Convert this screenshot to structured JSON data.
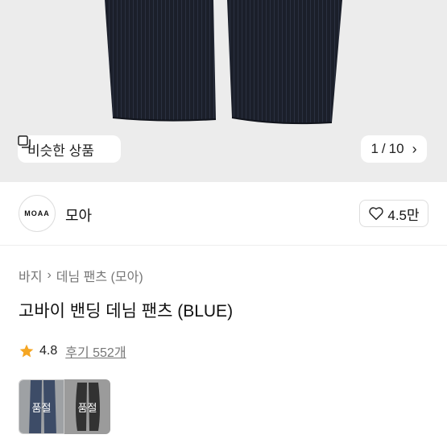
{
  "hero": {
    "similar_label": "비슷한 상품",
    "similar_icon": "similar-items-icon",
    "pager": {
      "current": "1",
      "separator": "/",
      "total": "10"
    },
    "pager_icon": "chevron-right-icon"
  },
  "brand": {
    "logo_text": "MOAA",
    "name": "모아",
    "like_count": "4.5만",
    "like_icon": "heart-outline-icon"
  },
  "breadcrumb": [
    "바지",
    "데님 팬츠 (모아)"
  ],
  "product": {
    "title": "고바이 밴딩 데님 팬츠 (BLUE)",
    "rating": "4.8",
    "reviews": "후기 552개",
    "star_color": "#f5a623"
  },
  "swatches": [
    {
      "label": "품절",
      "color": "#2f4a7a"
    },
    {
      "label": "품절",
      "color": "#1a1a1a"
    }
  ]
}
